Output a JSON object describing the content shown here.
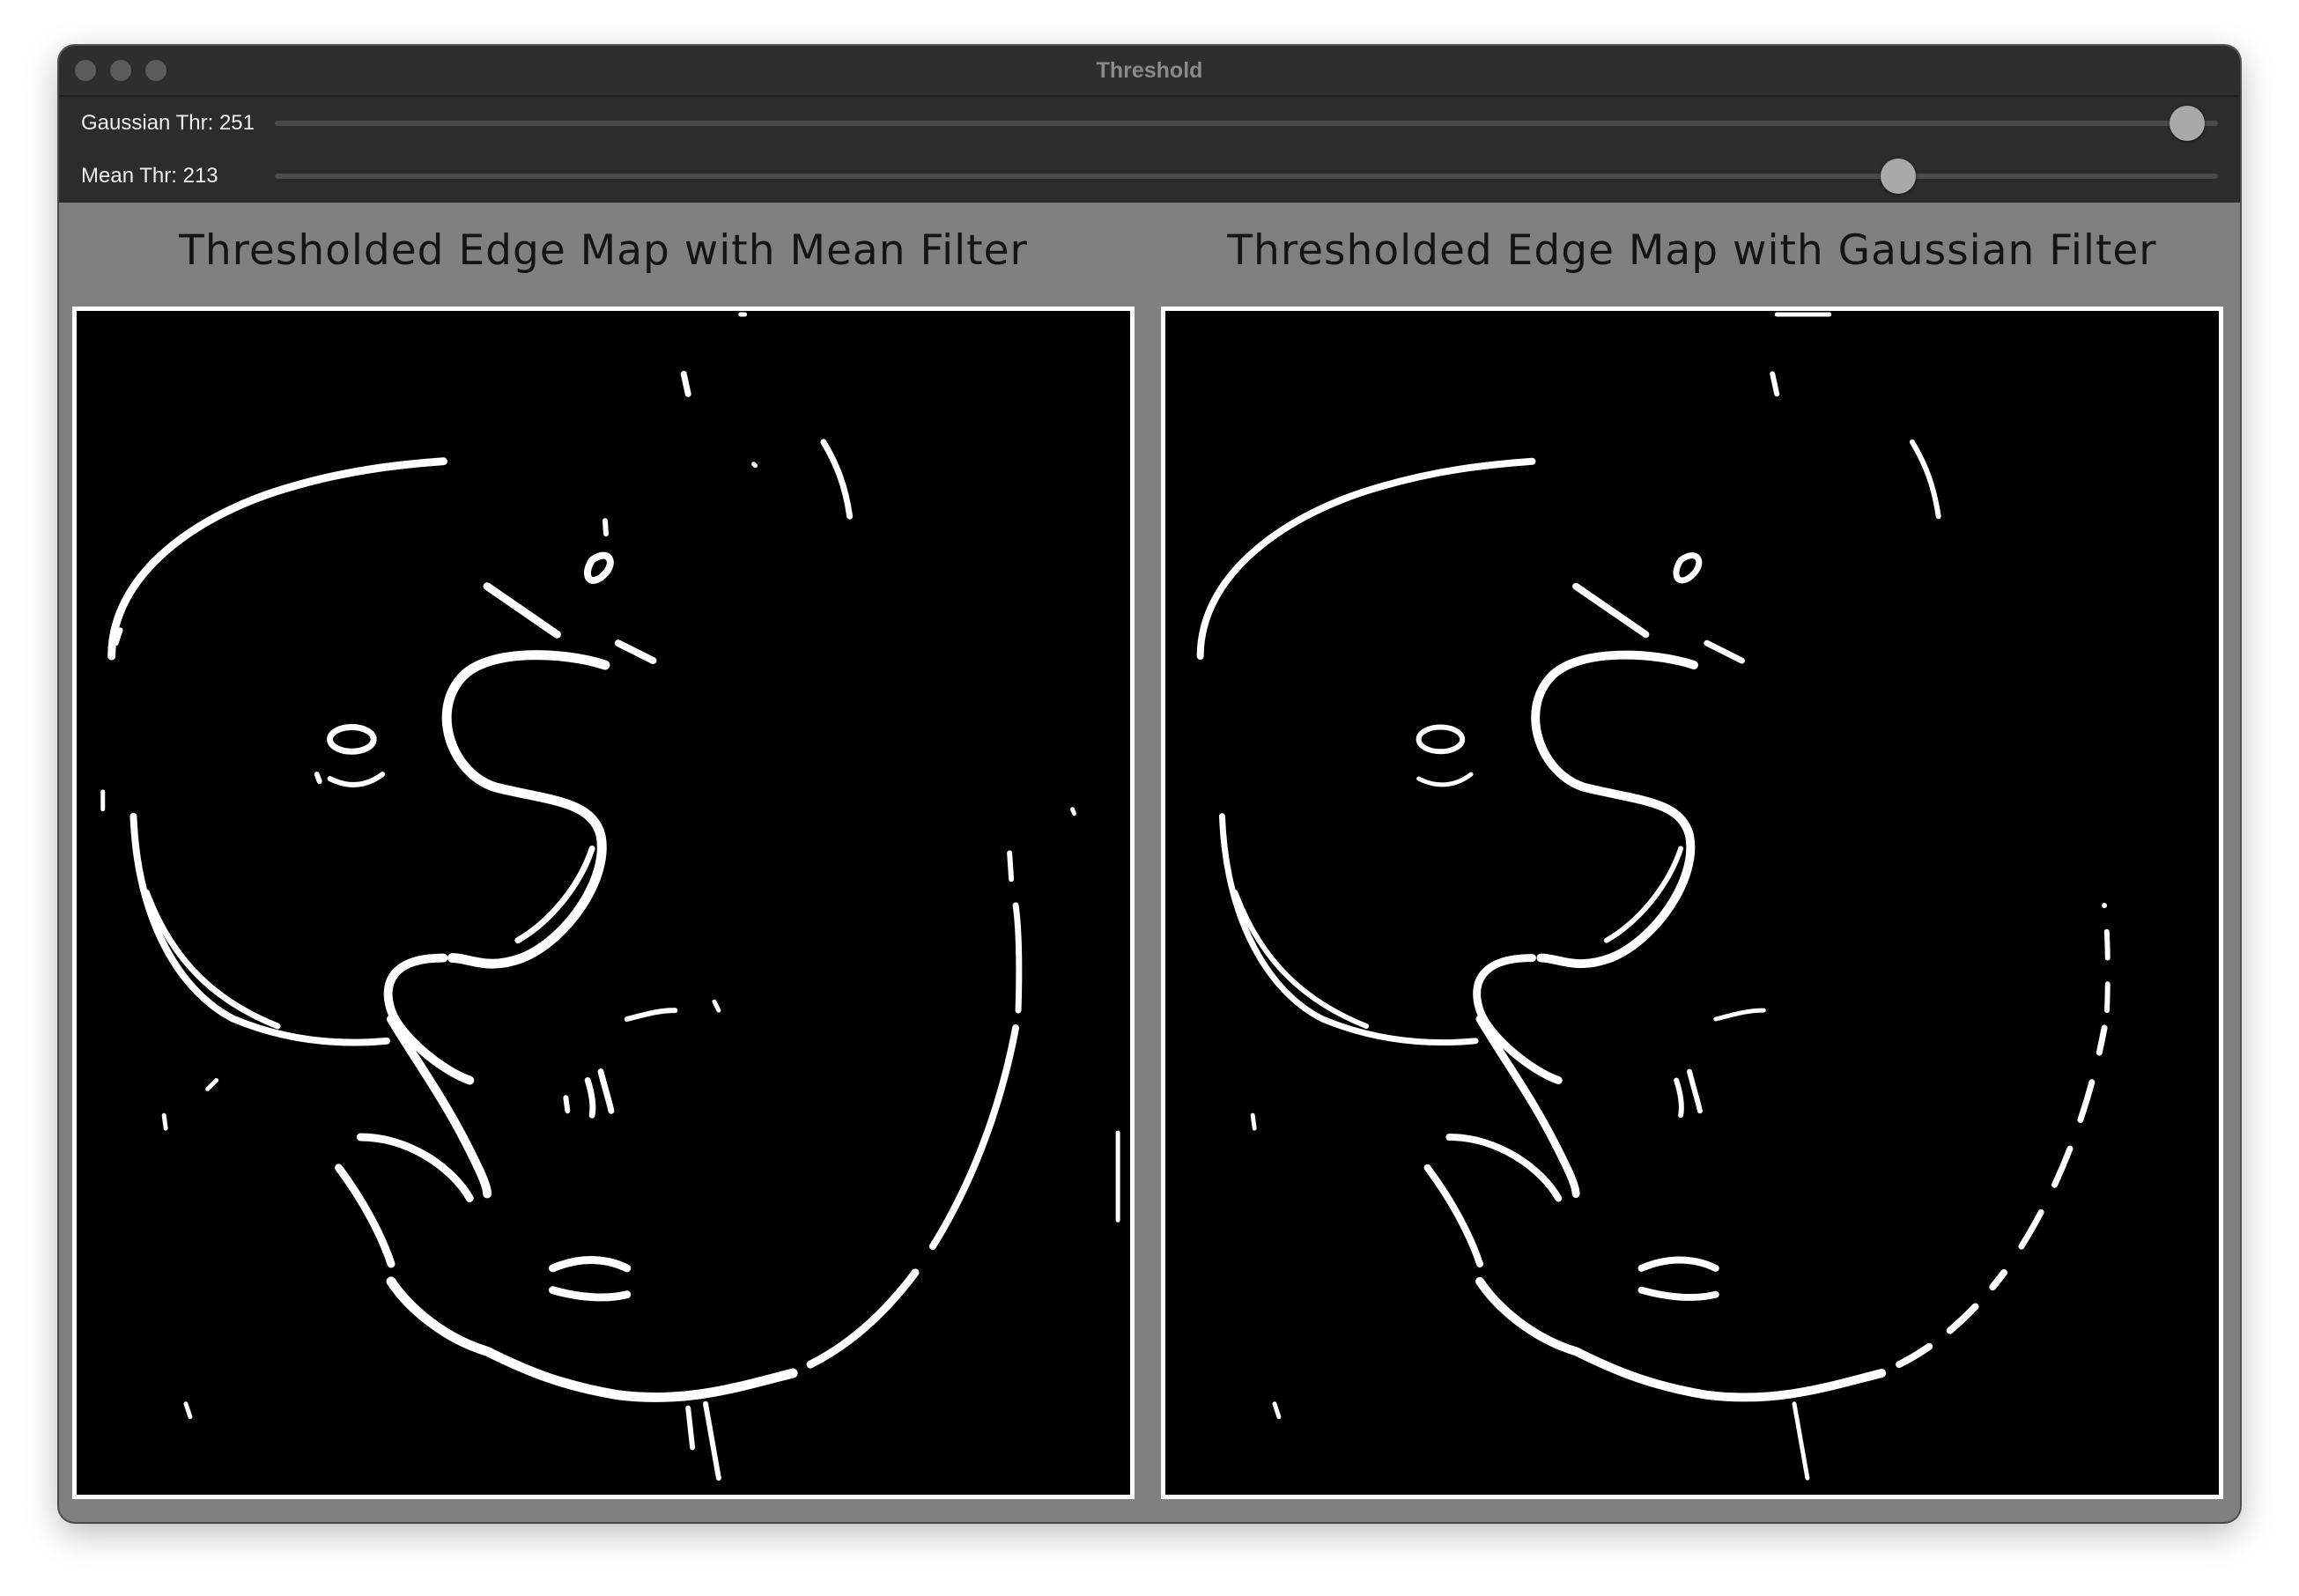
{
  "window": {
    "title": "Threshold"
  },
  "controls": {
    "gaussian": {
      "label": "Gaussian Thr: 251",
      "value": 251,
      "max": 255
    },
    "mean": {
      "label": "Mean Thr: 213",
      "value": 213,
      "max": 255
    }
  },
  "panels": [
    {
      "title": "Thresholded Edge Map with Mean Filter"
    },
    {
      "title": "Thresholded Edge Map with Gaussian Filter"
    }
  ]
}
